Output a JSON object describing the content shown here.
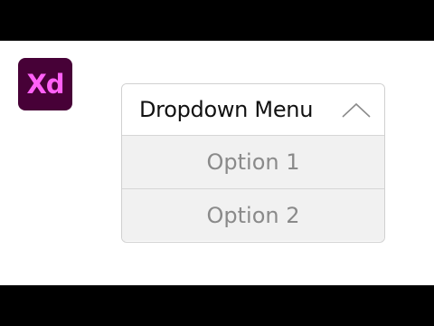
{
  "app": {
    "logo_text": "Xd",
    "logo_bg": "#470137",
    "logo_fg": "#ff61f6"
  },
  "dropdown": {
    "title": "Dropdown Menu",
    "chevron_icon": "chevron-up-icon",
    "options": [
      {
        "label": "Option 1"
      },
      {
        "label": "Option 2"
      }
    ]
  }
}
